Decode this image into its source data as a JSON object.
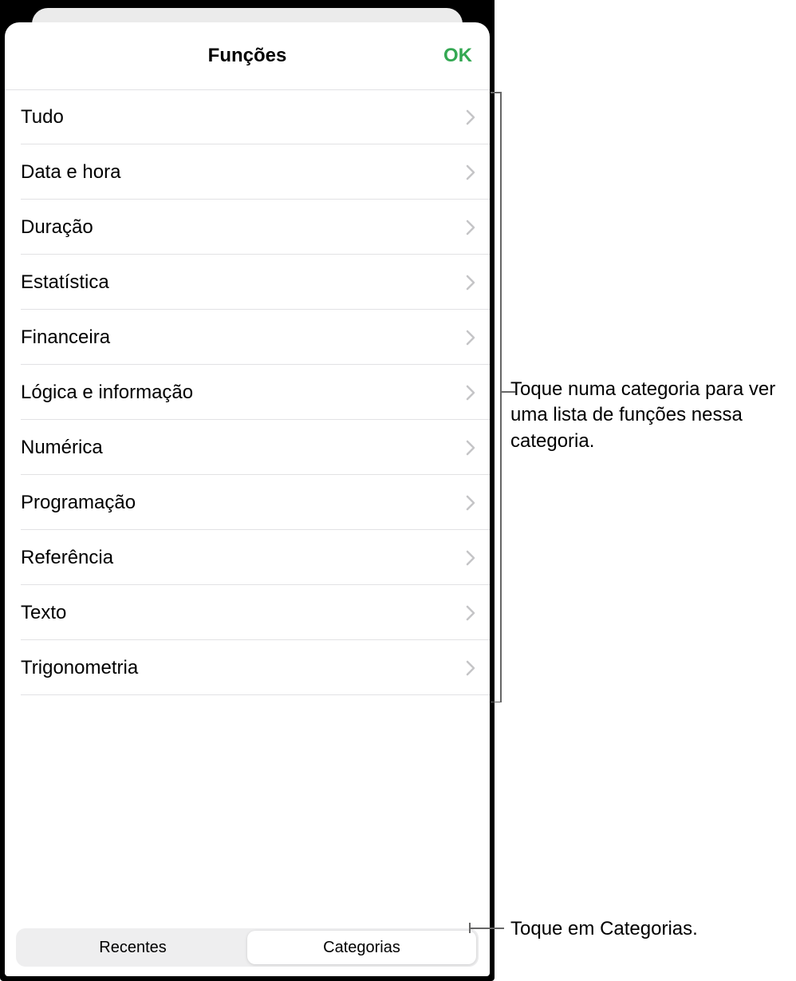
{
  "header": {
    "title": "Funções",
    "ok_label": "OK"
  },
  "categories": [
    {
      "label": "Tudo"
    },
    {
      "label": "Data e hora"
    },
    {
      "label": "Duração"
    },
    {
      "label": "Estatística"
    },
    {
      "label": "Financeira"
    },
    {
      "label": "Lógica e informação"
    },
    {
      "label": "Numérica"
    },
    {
      "label": "Programação"
    },
    {
      "label": "Referência"
    },
    {
      "label": "Texto"
    },
    {
      "label": "Trigonometria"
    }
  ],
  "segmented": {
    "recent_label": "Recentes",
    "categories_label": "Categorias",
    "active": "categories"
  },
  "callouts": {
    "list": "Toque numa categoria para ver uma lista de funções nessa categoria.",
    "segmented": "Toque em Categorias."
  }
}
